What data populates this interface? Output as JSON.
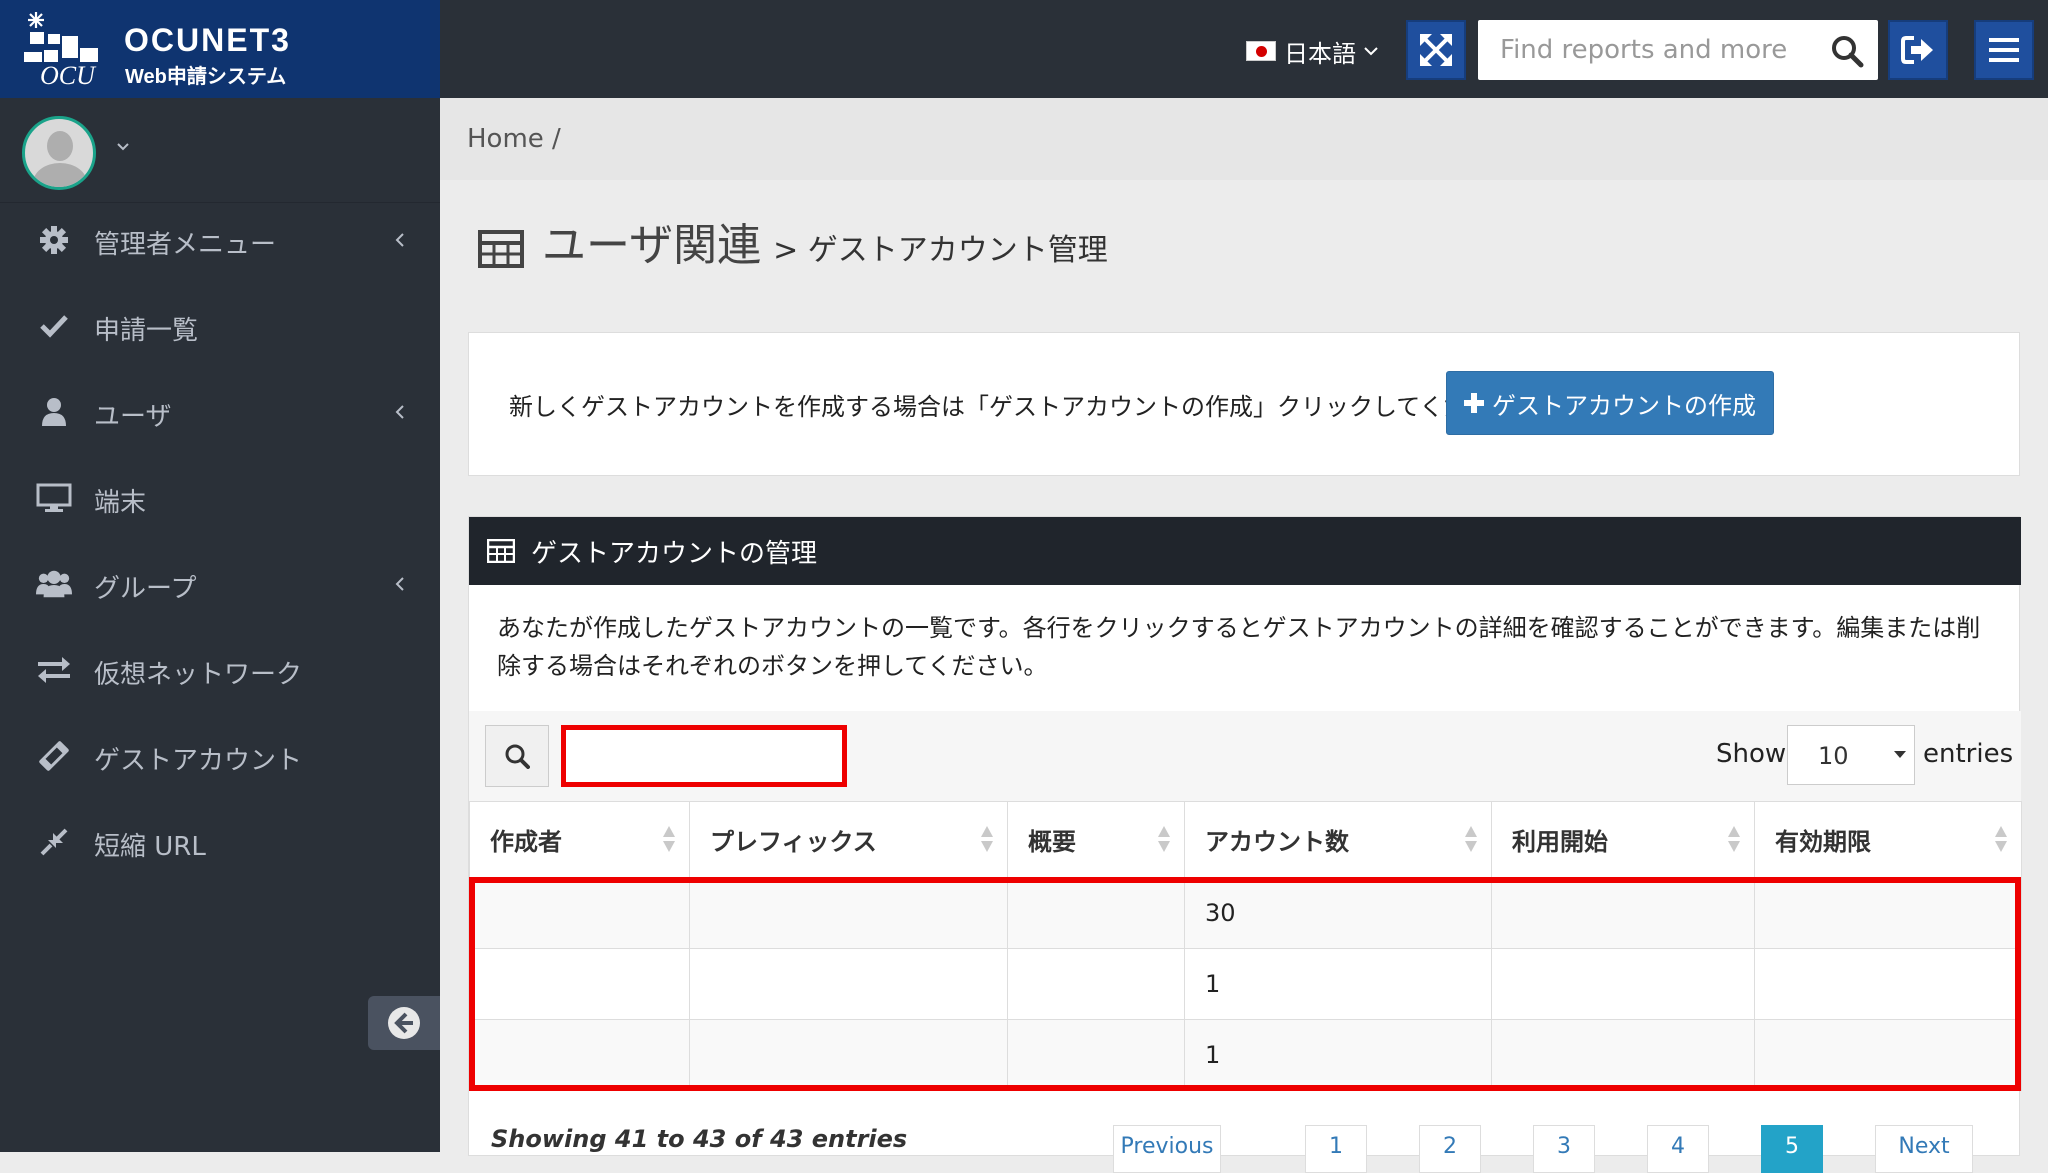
{
  "brand": {
    "name": "OCUNET3",
    "subtitle": "Web申請システム"
  },
  "topbar": {
    "language": "日本語",
    "search_placeholder": "Find reports and more"
  },
  "sidebar": {
    "items": [
      {
        "label": "管理者メニュー",
        "icon": "gear-icon",
        "has_children": true
      },
      {
        "label": "申請一覧",
        "icon": "check-icon",
        "has_children": false
      },
      {
        "label": "ユーザ",
        "icon": "user-icon",
        "has_children": true
      },
      {
        "label": "端末",
        "icon": "desktop-icon",
        "has_children": false
      },
      {
        "label": "グループ",
        "icon": "users-icon",
        "has_children": true
      },
      {
        "label": "仮想ネットワーク",
        "icon": "exchange-icon",
        "has_children": false
      },
      {
        "label": "ゲストアカウント",
        "icon": "ticket-icon",
        "has_children": false
      },
      {
        "label": "短縮 URL",
        "icon": "compress-icon",
        "has_children": false
      }
    ]
  },
  "breadcrumb": {
    "home": "Home",
    "sep": "/"
  },
  "page": {
    "title": "ユーザ関連",
    "subtitle": "> ゲストアカウント管理"
  },
  "info": {
    "message": "新しくゲストアカウントを作成する場合は「ゲストアカウントの作成」クリックしてください。",
    "create_button": "ゲストアカウントの作成"
  },
  "panel": {
    "title": "ゲストアカウントの管理",
    "description": "あなたが作成したゲストアカウントの一覧です。各行をクリックするとゲストアカウントの詳細を確認することができます。編集または削除する場合はそれぞれのボタンを押してください。",
    "show_label": "Show",
    "entries_value": "10",
    "entries_label": "entries",
    "columns": [
      "作成者",
      "プレフィックス",
      "概要",
      "アカウント数",
      "利用開始",
      "有効期限"
    ],
    "rows": [
      [
        "",
        "",
        "",
        "30",
        "",
        ""
      ],
      [
        "",
        "",
        "",
        "1",
        "",
        ""
      ],
      [
        "",
        "",
        "",
        "1",
        "",
        ""
      ]
    ],
    "info_text": "Showing 41 to 43 of 43 entries",
    "pagination": [
      "Previous",
      "1",
      "2",
      "3",
      "4",
      "5",
      "Next"
    ],
    "active_page": "5"
  },
  "colors": {
    "brand_bg": "#0f3470",
    "sidebar_bg": "#2a3038",
    "primary": "#337ab7",
    "highlight": "#ee0000",
    "active_page": "#23a3c8"
  }
}
